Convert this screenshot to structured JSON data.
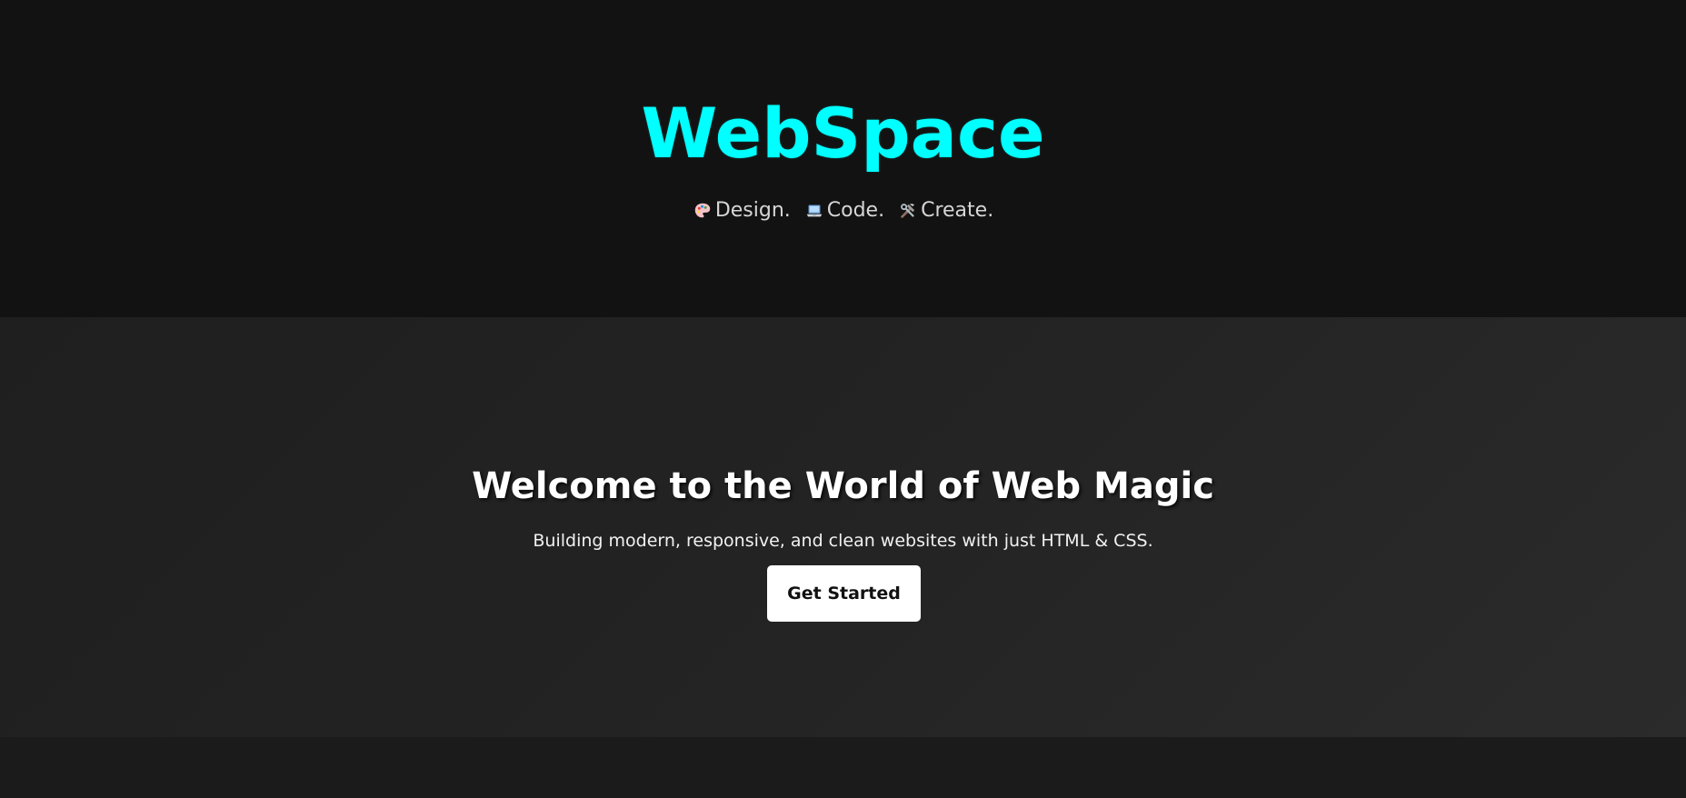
{
  "header": {
    "brand": "WebSpace",
    "tagline": {
      "design": "Design.",
      "code": "Code.",
      "create": "Create."
    },
    "icons": {
      "design": "palette-icon",
      "code": "laptop-icon",
      "create": "tools-icon"
    }
  },
  "hero": {
    "title": "Welcome to the World of Web Magic",
    "subtitle": "Building modern, responsive, and clean websites with just HTML & CSS.",
    "cta_label": "Get Started"
  },
  "colors": {
    "header_background": "#121212",
    "brand": "#00ffff",
    "hero_background": "#232323",
    "button_background": "#ffffff",
    "button_text": "#111111"
  }
}
